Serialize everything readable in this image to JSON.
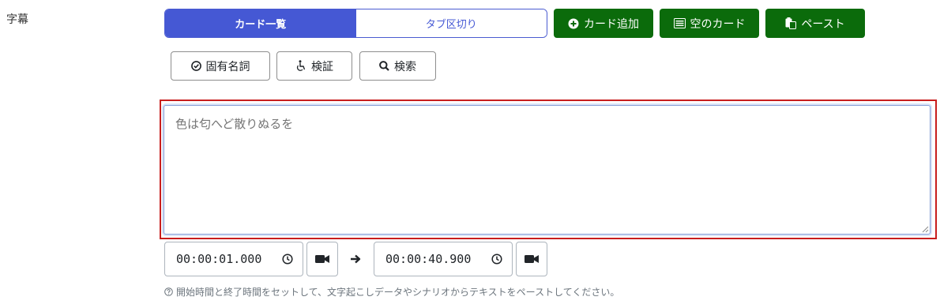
{
  "field": {
    "label": "字幕"
  },
  "view_toggle": {
    "card_list": "カード一覧",
    "tab_split": "タブ区切り"
  },
  "actions": {
    "add_card": "カード追加",
    "empty_card": "空のカード",
    "paste": "ペースト"
  },
  "tools": {
    "proper_noun": "固有名詞",
    "verify": "検証",
    "search": "検索"
  },
  "editor": {
    "placeholder": "色は匂へど散りぬるを"
  },
  "time": {
    "start": "00:00:01.000",
    "end": "00:00:40.900"
  },
  "help": {
    "text": "開始時間と終了時間をセットして、文字起こしデータやシナリオからテキストをペーストしてください。"
  },
  "colors": {
    "primary": "#4558d4",
    "green": "#0b6b0b",
    "frame_red": "#c81e1e"
  }
}
